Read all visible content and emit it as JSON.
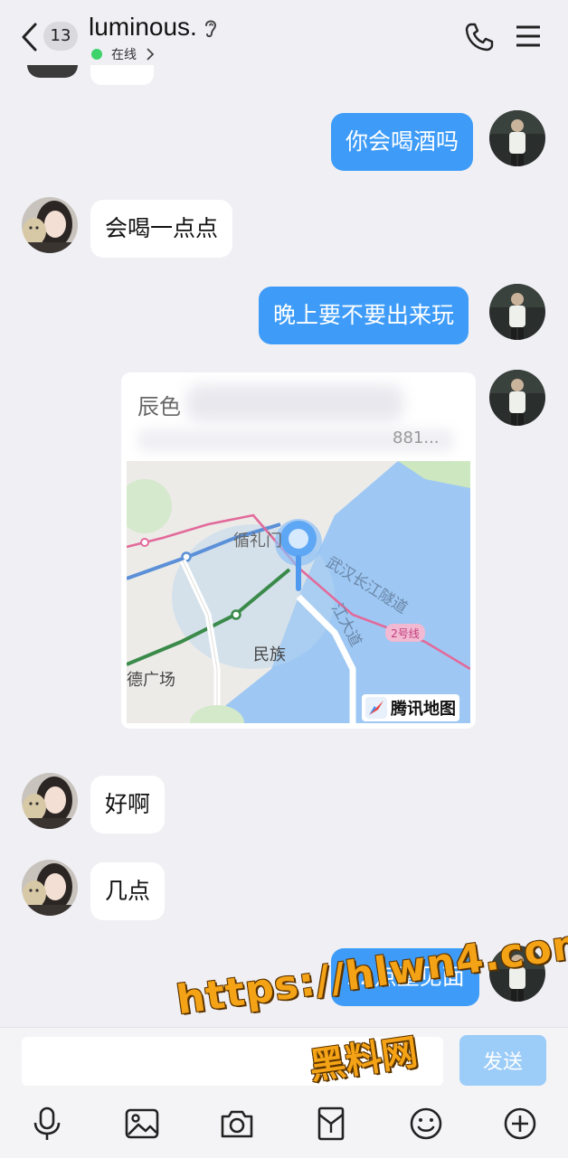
{
  "header": {
    "unread_count": "13",
    "contact_name": "luminous.",
    "status": "在线"
  },
  "messages": [
    {
      "side": "out",
      "text": "你会喝酒吗"
    },
    {
      "side": "in",
      "text": "会喝一点点"
    },
    {
      "side": "out",
      "text": "晚上要不要出来玩"
    },
    {
      "side": "out",
      "type": "location",
      "title": "辰色",
      "subtitle": "881..."
    },
    {
      "side": "in",
      "text": "好啊"
    },
    {
      "side": "in",
      "text": "几点"
    },
    {
      "side": "out",
      "text": "12点整见面"
    }
  ],
  "map": {
    "labels": [
      "循礼门",
      "武汉长江隧道",
      "江大道",
      "2号线",
      "民族",
      "德广场"
    ],
    "provider": "腾讯地图"
  },
  "input": {
    "placeholder": "",
    "send_label": "发送"
  },
  "toolbar": {
    "icons": [
      "microphone-icon",
      "image-icon",
      "camera-icon",
      "red-packet-icon",
      "emoji-icon",
      "plus-icon"
    ]
  },
  "watermark": {
    "url": "https://hlwn4.com",
    "text": "黑料网"
  },
  "colors": {
    "outgoing_bubble": "#3e9cf8",
    "incoming_bubble": "#ffffff",
    "background": "#efeff4",
    "online_dot": "#3ed26b",
    "send_button": "#9cccf8",
    "watermark": "#f5a316"
  }
}
